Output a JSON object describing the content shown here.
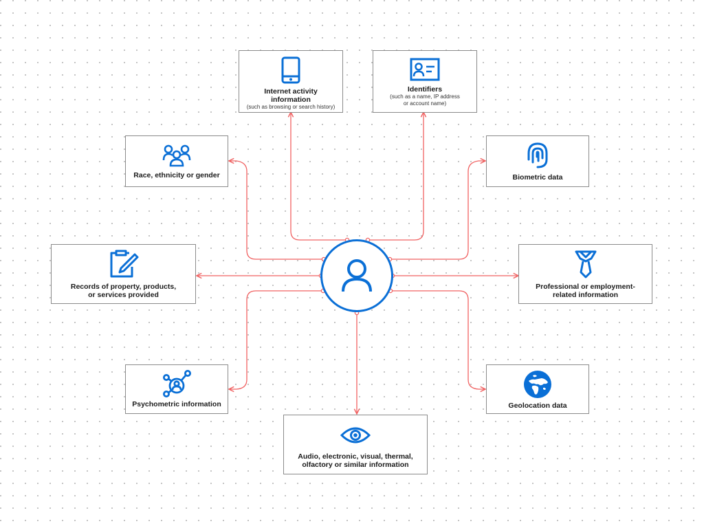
{
  "diagram": {
    "center": {
      "label": "User",
      "icon": "user-icon"
    },
    "colors": {
      "accent": "#0a6fd6",
      "connector": "#f06262",
      "border": "#8a8a8a"
    },
    "nodes": {
      "internet": {
        "title": "Internet activity information",
        "subtitle": "(such as browsing or search history)",
        "icon": "tablet-icon"
      },
      "identifiers": {
        "title": "Identifiers",
        "subtitle": "(such as a name, IP address or account name)",
        "icon": "id-card-icon"
      },
      "race": {
        "title": "Race, ethnicity or gender",
        "icon": "people-group-icon"
      },
      "biometric": {
        "title": "Biometric data",
        "icon": "fingerprint-icon"
      },
      "records": {
        "title": "Records of property, products, or services provided",
        "icon": "clipboard-pencil-icon"
      },
      "professional": {
        "title": "Professional or employment-related information",
        "icon": "necktie-icon"
      },
      "psychometric": {
        "title": "Psychometric information",
        "icon": "network-person-icon"
      },
      "geolocation": {
        "title": "Geolocation data",
        "icon": "globe-icon"
      },
      "audio": {
        "title": "Audio, electronic, visual, thermal, olfactory or similar information",
        "icon": "eye-icon"
      }
    }
  }
}
